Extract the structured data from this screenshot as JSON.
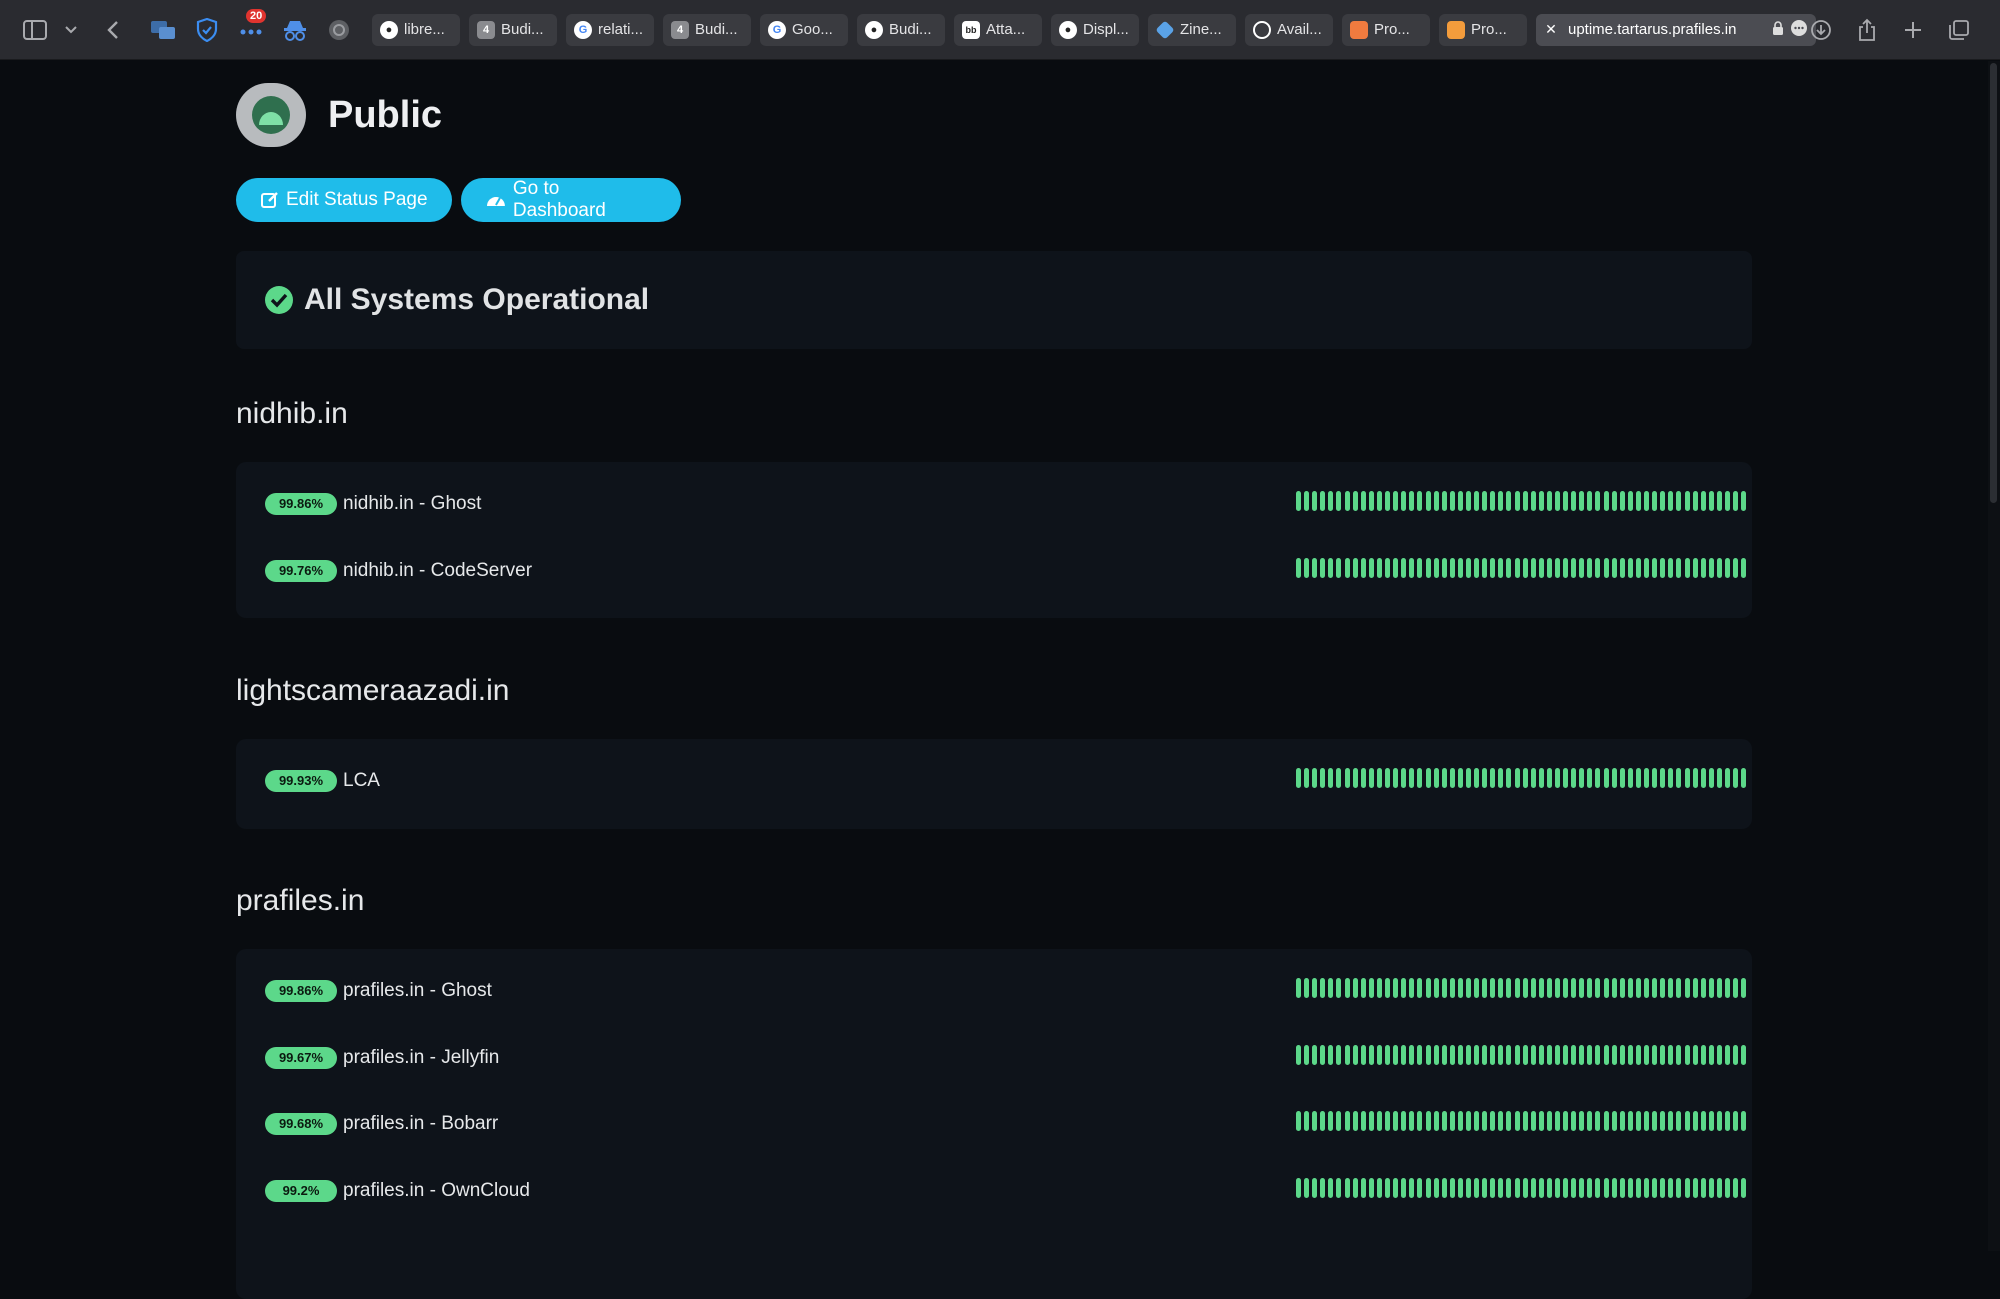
{
  "browser": {
    "notification_count": "20",
    "tabs": [
      {
        "label": "libre...",
        "icon": "github-icon"
      },
      {
        "label": "Budi...",
        "icon": "gray-box-icon"
      },
      {
        "label": "relati...",
        "icon": "google-icon"
      },
      {
        "label": "Budi...",
        "icon": "gray-box-icon"
      },
      {
        "label": "Goo...",
        "icon": "google-icon"
      },
      {
        "label": "Budi...",
        "icon": "github-icon"
      },
      {
        "label": "Atta...",
        "icon": "bb-icon"
      },
      {
        "label": "Displ...",
        "icon": "github-icon"
      },
      {
        "label": "Zine...",
        "icon": "cube-icon"
      },
      {
        "label": "Avail...",
        "icon": "circle-icon"
      },
      {
        "label": "Pro...",
        "icon": "orange-icon"
      },
      {
        "label": "Pro...",
        "icon": "orange-book-icon"
      }
    ],
    "active_tab": {
      "url": "uptime.tartarus.prafiles.in"
    }
  },
  "page": {
    "title": "Public",
    "edit_button": "Edit Status Page",
    "dashboard_button": "Go to Dashboard",
    "overall_status": "All Systems Operational",
    "status_color": "#5cd88a",
    "button_color": "#1fbcea"
  },
  "groups": [
    {
      "name": "nidhib.in",
      "monitors": [
        {
          "uptime": "99.86%",
          "name": "nidhib.in - Ghost"
        },
        {
          "uptime": "99.76%",
          "name": "nidhib.in - CodeServer"
        }
      ]
    },
    {
      "name": "lightscameraazadi.in",
      "monitors": [
        {
          "uptime": "99.93%",
          "name": "LCA"
        }
      ]
    },
    {
      "name": "prafiles.in",
      "monitors": [
        {
          "uptime": "99.86%",
          "name": "prafiles.in - Ghost"
        },
        {
          "uptime": "99.67%",
          "name": "prafiles.in - Jellyfin"
        },
        {
          "uptime": "99.68%",
          "name": "prafiles.in - Bobarr"
        },
        {
          "uptime": "99.2%",
          "name": "prafiles.in - OwnCloud"
        }
      ]
    }
  ]
}
